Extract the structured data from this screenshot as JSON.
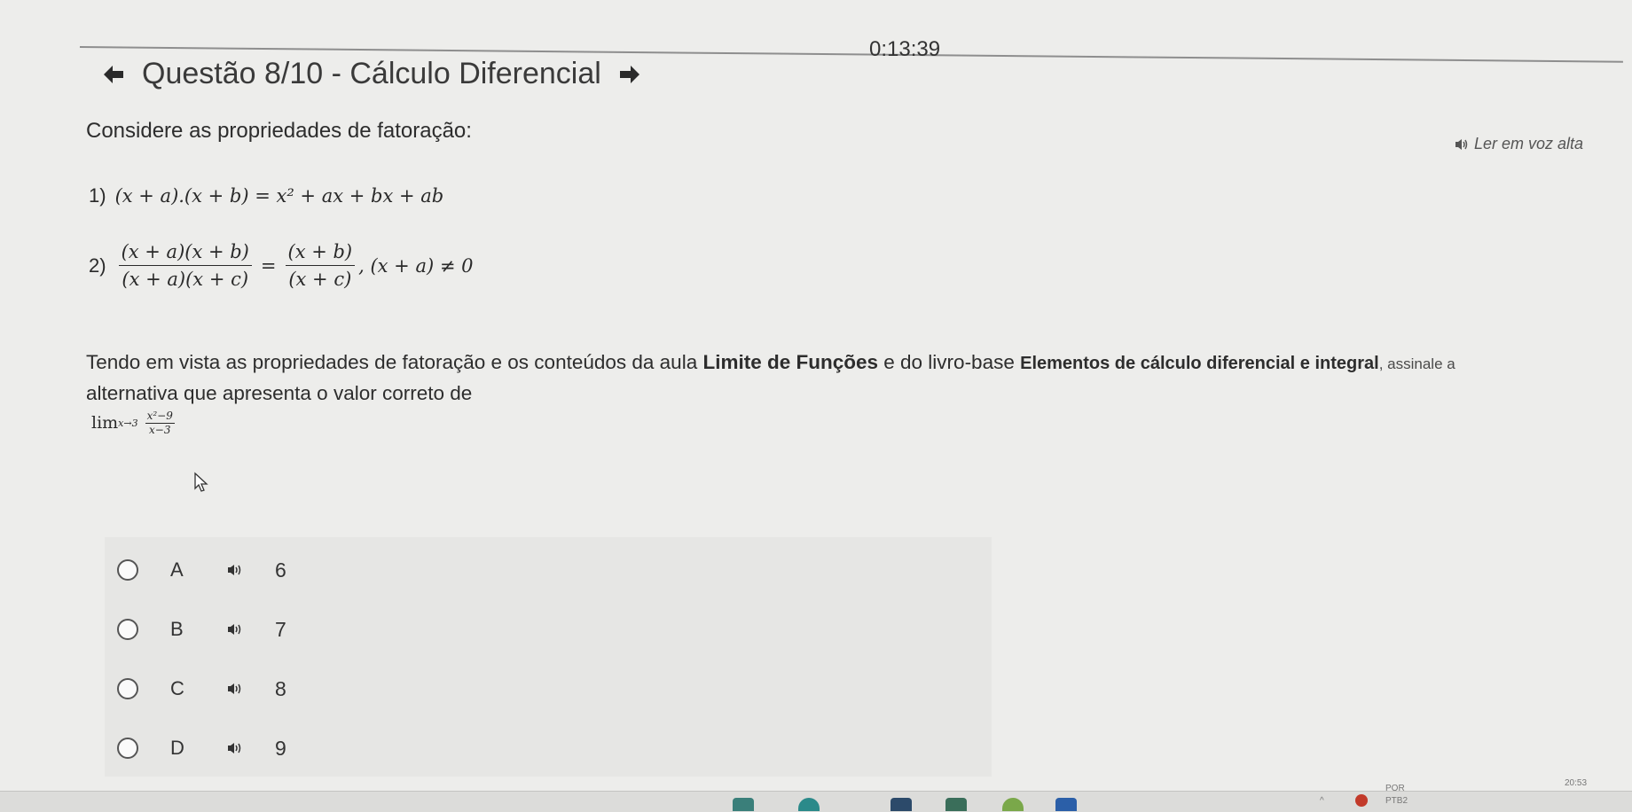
{
  "timer": "0:13:39",
  "header": {
    "title": "Questão 8/10 - Cálculo Diferencial"
  },
  "question": {
    "intro": "Considere as propriedades de fatoração:",
    "read_aloud": "Ler em voz alta",
    "prop1": {
      "num": "1)",
      "text": "(x + a).(x + b) = x² + ax + bx + ab"
    },
    "prop2": {
      "num": "2)",
      "lhs_num": "(x + a)(x + b)",
      "lhs_den": "(x + a)(x + c)",
      "eq": "=",
      "rhs_num": "(x + b)",
      "rhs_den": "(x + c)",
      "cond": ", (x + a) ≠ 0"
    },
    "stmt_a": "Tendo em vista as propriedades de fatoração e os conteúdos da aula ",
    "stmt_b1": "Limite de Funções",
    "stmt_c": " e do livro-base ",
    "stmt_b2": "Elementos de cálculo diferencial e integral",
    "stmt_tail": ", assinale a",
    "stmt_line2": "alternativa que apresenta o valor correto de",
    "limit": {
      "lim": "lim",
      "sub": "x→3",
      "num": "x²−9",
      "den": "x−3"
    }
  },
  "options": [
    {
      "letter": "A",
      "value": "6"
    },
    {
      "letter": "B",
      "value": "7"
    },
    {
      "letter": "C",
      "value": "8"
    },
    {
      "letter": "D",
      "value": "9"
    }
  ],
  "taskbar": {
    "tray_lang": "POR",
    "tray_layout": "PTB2",
    "tray_time": "20:53"
  }
}
